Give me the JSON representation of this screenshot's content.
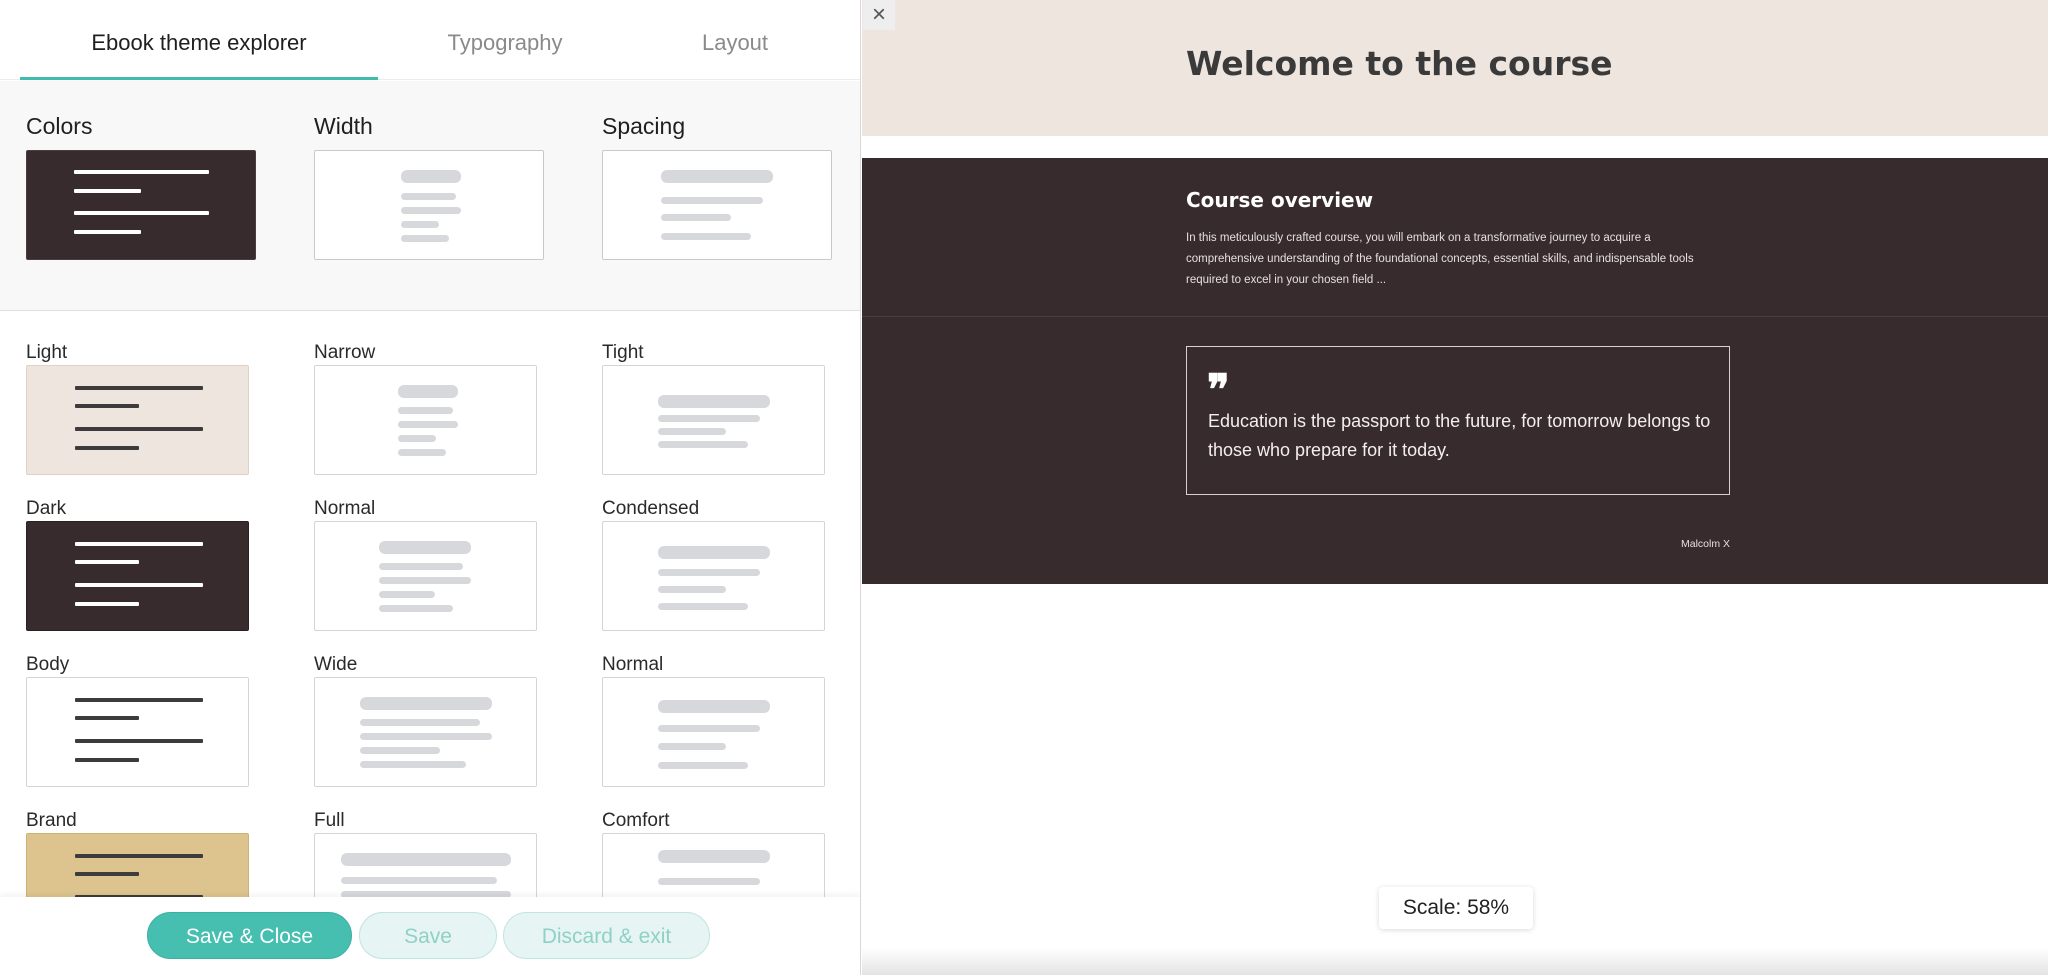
{
  "tabs": [
    {
      "label": "Ebook theme explorer",
      "active": true
    },
    {
      "label": "Typography",
      "active": false
    },
    {
      "label": "Layout",
      "active": false
    }
  ],
  "summary": {
    "colors_title": "Colors",
    "width_title": "Width",
    "spacing_title": "Spacing"
  },
  "options": {
    "colors": [
      "Light",
      "Dark",
      "Body",
      "Brand"
    ],
    "width": [
      "Narrow",
      "Normal",
      "Wide",
      "Full"
    ],
    "spacing": [
      "Tight",
      "Condensed",
      "Normal",
      "Comfort"
    ]
  },
  "footer": {
    "save_close_label": "Save & Close",
    "save_label": "Save",
    "discard_label": "Discard & exit"
  },
  "preview": {
    "close_icon": "×",
    "hero_title": "Welcome to the course",
    "overview_title": "Course overview",
    "overview_body": "In this meticulously crafted course, you will embark on a transformative journey to acquire a comprehensive understanding of the foundational concepts, essential skills, and indispensable tools required to excel in your chosen field ...",
    "quote_mark": "❞",
    "quote_text": "Education is the passport to the future, for tomorrow belongs to those who prepare for it today.",
    "quote_author": "Malcolm X",
    "scale_label": "Scale: 58%"
  },
  "colors": {
    "accent": "#47bfb0",
    "dark_theme": "#372b2e",
    "light_theme": "#ede5de",
    "brand_theme": "#ddc48e"
  }
}
